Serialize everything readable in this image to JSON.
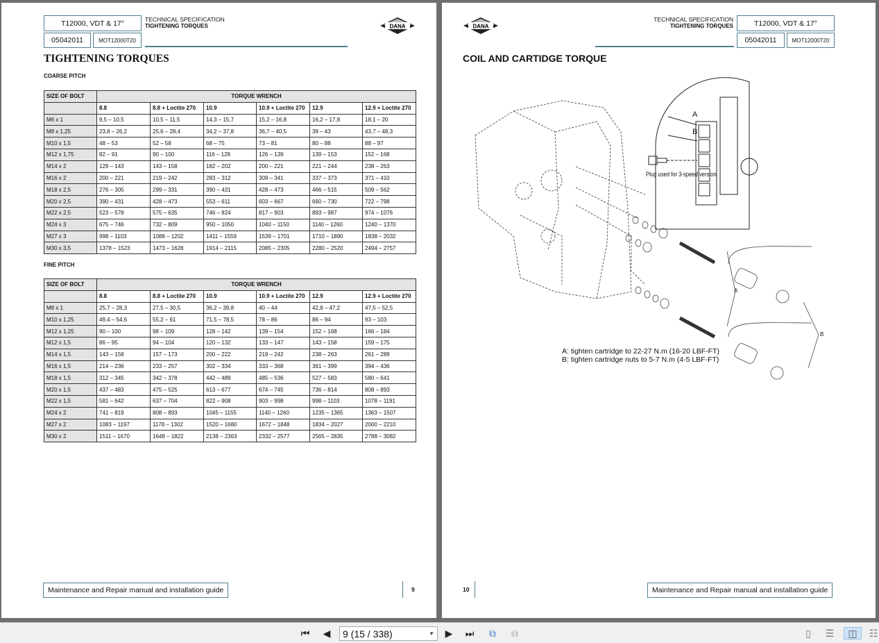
{
  "header": {
    "model": "T12000, VDT & 17°",
    "date_code": "05042011",
    "doc_code": "MOT12000T20",
    "spec_line1": "TECHNICAL SPECIFICATION",
    "spec_line2": "TIGHTENING TORQUES",
    "logo_text": "DANA"
  },
  "left_page": {
    "title": "TIGHTENING TORQUES",
    "coarse_label": "COARSE PITCH",
    "fine_label": "FINE PITCH",
    "footer": "Maintenance and Repair manual and installation guide",
    "page_number": "9"
  },
  "table_headers": {
    "size": "SIZE OF BOLT",
    "group": "TORQUE WRENCH",
    "columns": [
      "8.8",
      "8.8 + Loctite 270",
      "10.9",
      "10.9 + Loctite 270",
      "12.9",
      "12.9 + Loctite 270"
    ]
  },
  "coarse_rows": [
    [
      "M6 x 1",
      "9,5 – 10,5",
      "10,5 – 11,5",
      "14,3 – 15,7",
      "15,2 – 16,8",
      "16,2 – 17,8",
      "18,1 – 20"
    ],
    [
      "M8 x 1,25",
      "23,8 – 26,2",
      "25,6 – 28,4",
      "34,2 – 37,8",
      "36,7 – 40,5",
      "39 – 43",
      "43,7 – 48,3"
    ],
    [
      "M10 x 1,5",
      "48 – 53",
      "52 – 58",
      "68 – 75",
      "73 – 81",
      "80 – 88",
      "88 – 97"
    ],
    [
      "M12 x 1,75",
      "82 – 91",
      "90 – 100",
      "116 – 128",
      "126 – 139",
      "139 – 153",
      "152 – 168"
    ],
    [
      "M14 x 2",
      "129 – 143",
      "143 – 158",
      "182 – 202",
      "200 – 221",
      "221 – 244",
      "238 – 263"
    ],
    [
      "M16 x 2",
      "200 – 221",
      "219 – 242",
      "283 – 312",
      "309 – 341",
      "337 – 373",
      "371 – 410"
    ],
    [
      "M18 x 2,5",
      "276 – 305",
      "299 – 331",
      "390 – 431",
      "428 – 473",
      "466 – 515",
      "509 – 562"
    ],
    [
      "M20 x 2,5",
      "390 – 431",
      "428 – 473",
      "553 – 611",
      "603 – 667",
      "660 – 730",
      "722 – 798"
    ],
    [
      "M22 x 2,5",
      "523 – 578",
      "575 – 635",
      "746 – 824",
      "817 – 903",
      "893 – 987",
      "974 – 1076"
    ],
    [
      "M24 x 3",
      "675 – 746",
      "732 – 809",
      "950 – 1050",
      "1040 – 1150",
      "1140 – 1260",
      "1240 – 1370"
    ],
    [
      "M27 x 3",
      "998 – 1103",
      "1088 – 1202",
      "1411 – 1559",
      "1539 – 1701",
      "1710 – 1890",
      "1838 – 2032"
    ],
    [
      "M30 x 3,5",
      "1378 – 1523",
      "1473 – 1628",
      "1914 – 2115",
      "2085 – 2305",
      "2280 – 2520",
      "2494 – 2757"
    ]
  ],
  "fine_rows": [
    [
      "M8 x 1",
      "25,7 – 28,3",
      "27,5 – 30,5",
      "36,2 – 39,8",
      "40 – 44",
      "42,8 – 47,2",
      "47,5 – 52,5"
    ],
    [
      "M10 x 1,25",
      "49,4 – 54,6",
      "55,2 – 61",
      "71,5 – 78,5",
      "78 – 86",
      "86 – 94",
      "93 – 103"
    ],
    [
      "M12 x 1,25",
      "90 – 100",
      "98 – 109",
      "128 – 142",
      "139 – 154",
      "152 – 168",
      "166 – 184"
    ],
    [
      "M12 x 1,5",
      "86 – 95",
      "94 – 104",
      "120 – 132",
      "133 – 147",
      "143 – 158",
      "159 – 175"
    ],
    [
      "M14 x 1,5",
      "143 – 158",
      "157 – 173",
      "200 – 222",
      "219 – 242",
      "238 – 263",
      "261 – 289"
    ],
    [
      "M16 x 1,5",
      "214 – 236",
      "233 – 257",
      "302 – 334",
      "333 – 368",
      "361 – 399",
      "394 – 436"
    ],
    [
      "M18 x 1,5",
      "312 – 345",
      "342 – 378",
      "442 – 489",
      "485 – 536",
      "527 – 583",
      "580 – 641"
    ],
    [
      "M20 x 1,5",
      "437 – 483",
      "475 – 525",
      "613 – 677",
      "674 – 745",
      "736 – 814",
      "808 – 893"
    ],
    [
      "M22 x 1,5",
      "581 – 642",
      "637 – 704",
      "822 – 908",
      "903 – 998",
      "998 – 1103",
      "1078 – 1191"
    ],
    [
      "M24 x 2",
      "741 – 819",
      "808 – 893",
      "1045 – 1155",
      "1140 – 1260",
      "1235 – 1365",
      "1363 – 1507"
    ],
    [
      "M27 x 2",
      "1083 – 1197",
      "1178 – 1302",
      "1520 – 1680",
      "1672 – 1848",
      "1834 – 2027",
      "2000 – 2210"
    ],
    [
      "M30 x 2",
      "1511 – 1670",
      "1648 – 1822",
      "2138 – 2363",
      "2332 – 2577",
      "2565 – 2835",
      "2788 – 3082"
    ]
  ],
  "right_page": {
    "title": "COIL AND CARTIDGE TORQUE",
    "label_a": "A",
    "label_b": "B",
    "plug_note": "Plug used for 3-speed version",
    "note_a": "A: tighten cartridge to 22-27 N.m (16-20 LBF-FT)",
    "note_b": "B: tighten cartridge nuts to 5-7 N.m (4-5 LBF-FT)",
    "footer": "Maintenance and Repair manual and installation guide",
    "page_number": "10"
  },
  "toolbar": {
    "page_select_value": "9 (15 / 338)",
    "icons": [
      "first-page-icon",
      "previous-page-icon",
      "next-page-icon",
      "last-page-icon",
      "previous-view-icon",
      "next-view-icon",
      "single-page-icon",
      "continuous-icon",
      "facing-icon",
      "continuous-facing-icon"
    ],
    "active_view": "facing"
  }
}
